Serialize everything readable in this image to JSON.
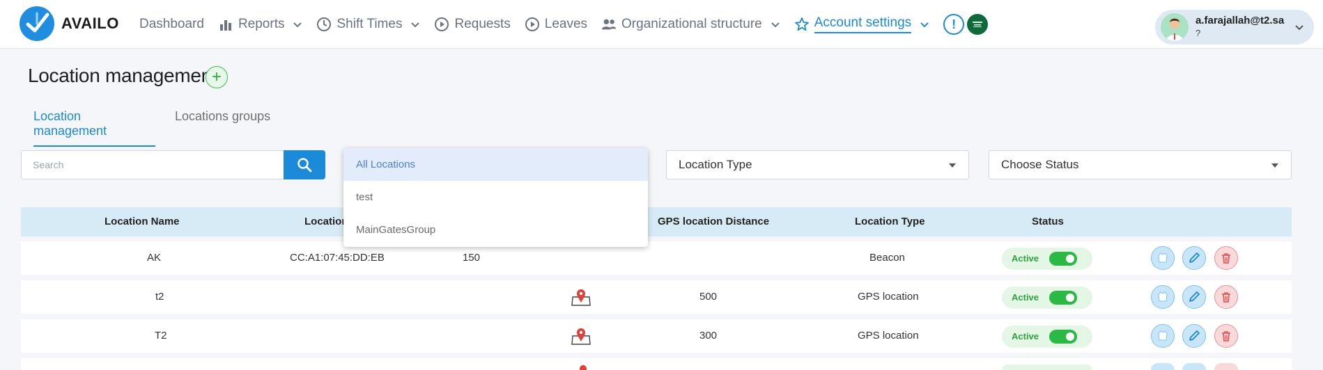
{
  "app": {
    "name": "AVAILO"
  },
  "nav": {
    "items": [
      {
        "label": "Dashboard",
        "icon": "",
        "has_chevron": false
      },
      {
        "label": "Reports",
        "icon": "bar-chart-icon",
        "has_chevron": true
      },
      {
        "label": "Shift Times",
        "icon": "clock-icon",
        "has_chevron": true
      },
      {
        "label": "Requests",
        "icon": "play-circle-icon",
        "has_chevron": false
      },
      {
        "label": "Leaves",
        "icon": "play-circle-icon",
        "has_chevron": false
      },
      {
        "label": "Organizational structure",
        "icon": "people-icon",
        "has_chevron": true
      },
      {
        "label": "Account settings",
        "icon": "star-icon",
        "has_chevron": true,
        "active": true
      }
    ],
    "alert_symbol": "!"
  },
  "user": {
    "email": "a.farajallah@t2.sa",
    "subtitle": "?"
  },
  "page": {
    "title": "Location management",
    "add_symbol": "+",
    "tabs": [
      {
        "label": "Location management",
        "active": true
      },
      {
        "label": "Locations groups",
        "active": false
      }
    ]
  },
  "filters": {
    "search_placeholder": "Search",
    "location_group_options": [
      "All Locations",
      "test",
      "MainGatesGroup"
    ],
    "location_group_selected": "All Locations",
    "location_type_placeholder": "Location Type",
    "status_placeholder": "Choose Status"
  },
  "table": {
    "headers": {
      "name": "Location Name",
      "location": "Location",
      "gps_distance": "GPS location Distance",
      "type": "Location Type",
      "status": "Status"
    },
    "rows": [
      {
        "name": "AK",
        "mac": "CC:A1:07:45:DD:EB",
        "range": "150",
        "has_map": false,
        "gps_distance": "",
        "type": "Beacon",
        "status": "Active"
      },
      {
        "name": "t2",
        "mac": "",
        "range": "",
        "has_map": true,
        "gps_distance": "500",
        "type": "GPS location",
        "status": "Active"
      },
      {
        "name": "T2",
        "mac": "",
        "range": "",
        "has_map": true,
        "gps_distance": "300",
        "type": "GPS location",
        "status": "Active"
      }
    ]
  },
  "colors": {
    "accent": "#1a8ad9",
    "header_row": "#d7ebf7",
    "active_green": "#29b944",
    "delete_red": "#e05a5a"
  }
}
